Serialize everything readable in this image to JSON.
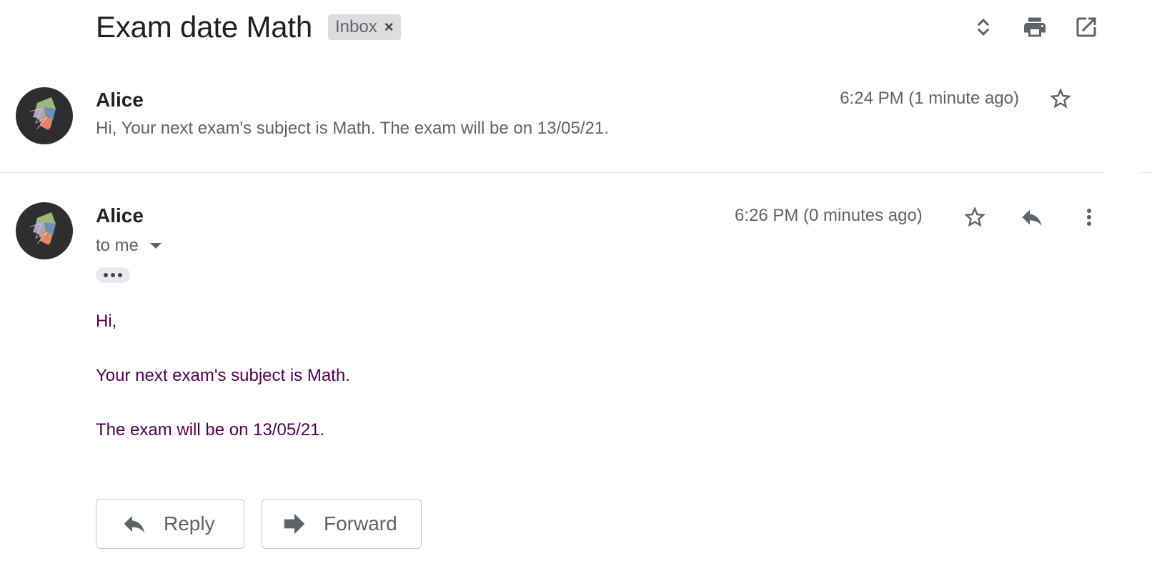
{
  "thread": {
    "subject": "Exam date Math",
    "label": "Inbox",
    "label_close": "×"
  },
  "top_actions": {
    "icons": [
      "expand-collapse-icon",
      "print-icon",
      "open-in-new-window-icon"
    ]
  },
  "messages": [
    {
      "sender": "Alice",
      "time": "6:24 PM (1 minute ago)",
      "snippet": "Hi, Your next exam's subject is Math. The exam will be on 13/05/21.",
      "collapsed": true
    },
    {
      "sender": "Alice",
      "time": "6:26 PM (0 minutes ago)",
      "recipient": "to me",
      "body": {
        "line1": "Hi,",
        "line2": "Your next exam's subject is Math.",
        "line3": "The exam will be on 13/05/21."
      },
      "collapsed": false
    }
  ],
  "actions": {
    "reply_label": "Reply",
    "forward_label": "Forward"
  },
  "colors": {
    "body_text": "#500050",
    "secondary_text": "#5f6368",
    "chip_bg": "#dddddd"
  }
}
